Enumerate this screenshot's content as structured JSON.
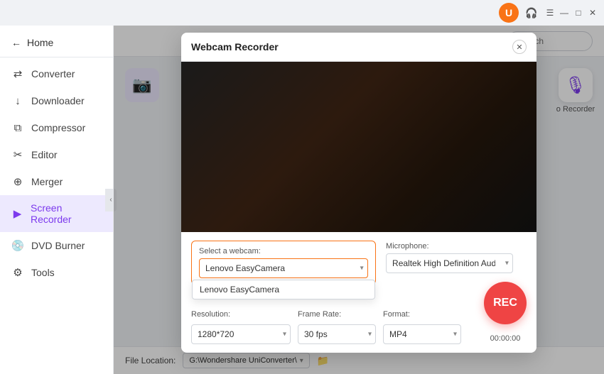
{
  "titlebar": {
    "user_icon": "U",
    "headphone_icon": "🎧",
    "menu_icon": "☰",
    "minimize": "—",
    "maximize": "□",
    "close": "✕"
  },
  "sidebar": {
    "home_label": "Home",
    "items": [
      {
        "id": "converter",
        "label": "Converter",
        "icon": "⇄"
      },
      {
        "id": "downloader",
        "label": "Downloader",
        "icon": "↓"
      },
      {
        "id": "compressor",
        "label": "Compressor",
        "icon": "⧉"
      },
      {
        "id": "editor",
        "label": "Editor",
        "icon": "✂"
      },
      {
        "id": "merger",
        "label": "Merger",
        "icon": "⊕"
      },
      {
        "id": "screen-recorder",
        "label": "Screen Recorder",
        "icon": "▶"
      },
      {
        "id": "dvd-burner",
        "label": "DVD Burner",
        "icon": "💿"
      },
      {
        "id": "tools",
        "label": "Tools",
        "icon": "⚙"
      }
    ],
    "active": "screen-recorder"
  },
  "topbar": {
    "search_placeholder": "Search"
  },
  "modal": {
    "title": "Webcam Recorder",
    "close_label": "✕",
    "webcam_label": "Select a webcam:",
    "webcam_selected": "Lenovo EasyCamera",
    "webcam_dropdown_item": "Lenovo EasyCamera",
    "mic_label": "Microphone:",
    "mic_selected": "Realtek High Definition Audio",
    "resolution_label": "Resolution:",
    "resolution_selected": "1280*720",
    "framerate_label": "Frame Rate:",
    "framerate_selected": "30 fps",
    "format_label": "Format:",
    "format_selected": "MP4",
    "rec_label": "REC",
    "timer": "00:00:00",
    "file_location_label": "File Location:",
    "file_path": "G:\\Wondershare UniConverter\\",
    "folder_icon": "📁"
  },
  "right_panel": {
    "mic_icon": "🎙",
    "recorder_label": "o Recorder"
  }
}
